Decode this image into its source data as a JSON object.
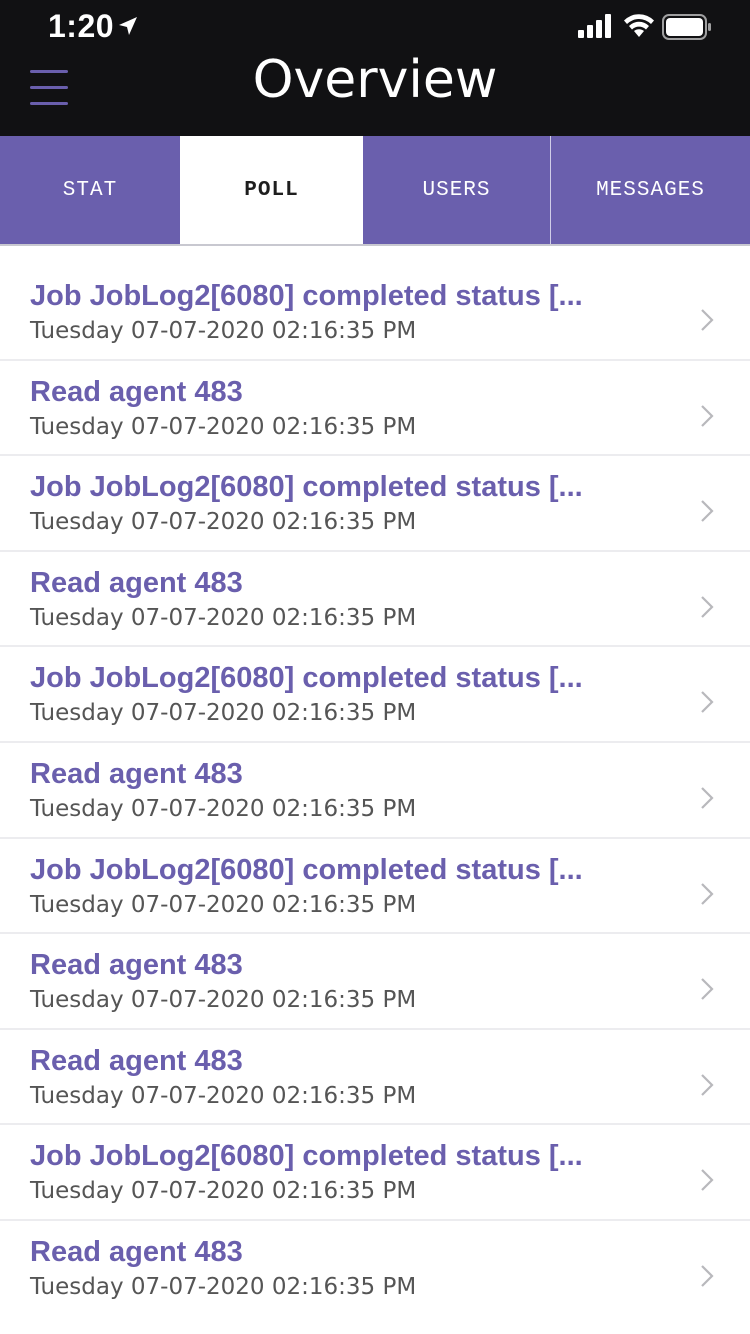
{
  "status_bar": {
    "time": "1:20"
  },
  "header": {
    "title": "Overview"
  },
  "tabs": [
    {
      "label": "STAT",
      "active": false
    },
    {
      "label": "POLL",
      "active": true
    },
    {
      "label": "USERS",
      "active": false
    },
    {
      "label": "MESSAGES",
      "active": false
    }
  ],
  "items": [
    {
      "title": "Job JobLog2[6080] completed status [...",
      "subtitle": "Tuesday 07-07-2020 02:16:35 PM"
    },
    {
      "title": "Read agent 483",
      "subtitle": "Tuesday 07-07-2020 02:16:35 PM"
    },
    {
      "title": "Job JobLog2[6080] completed status [...",
      "subtitle": "Tuesday 07-07-2020 02:16:35 PM"
    },
    {
      "title": "Read agent 483",
      "subtitle": "Tuesday 07-07-2020 02:16:35 PM"
    },
    {
      "title": "Job JobLog2[6080] completed status [...",
      "subtitle": "Tuesday 07-07-2020 02:16:35 PM"
    },
    {
      "title": "Read agent 483",
      "subtitle": "Tuesday 07-07-2020 02:16:35 PM"
    },
    {
      "title": "Job JobLog2[6080] completed status [...",
      "subtitle": "Tuesday 07-07-2020 02:16:35 PM"
    },
    {
      "title": "Read agent 483",
      "subtitle": "Tuesday 07-07-2020 02:16:35 PM"
    },
    {
      "title": "Read agent 483",
      "subtitle": "Tuesday 07-07-2020 02:16:35 PM"
    },
    {
      "title": "Job JobLog2[6080] completed status [...",
      "subtitle": "Tuesday 07-07-2020 02:16:35 PM"
    },
    {
      "title": "Read agent 483",
      "subtitle": "Tuesday 07-07-2020 02:16:35 PM"
    }
  ],
  "icons": {
    "location": "location-arrow-icon",
    "signal": "cellular-signal-icon",
    "wifi": "wifi-icon",
    "battery": "battery-icon",
    "menu": "hamburger-menu-icon",
    "chevron": "chevron-right-icon"
  },
  "colors": {
    "accent": "#6a5fad",
    "header_bg": "#111113",
    "text_secondary": "#555555"
  }
}
